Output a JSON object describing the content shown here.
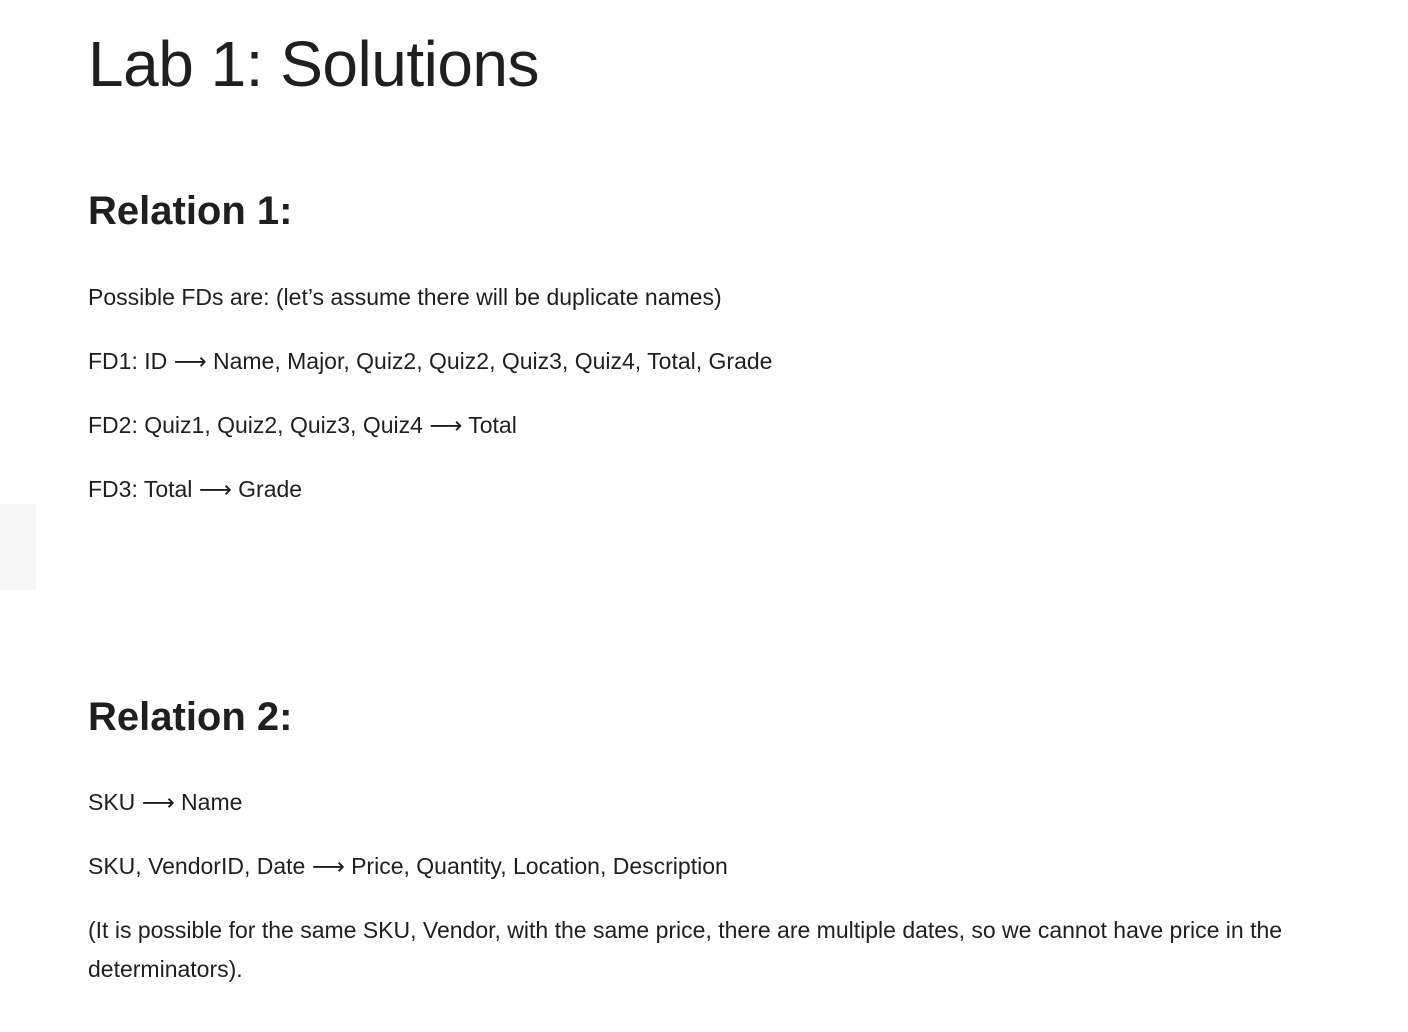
{
  "title": "Lab 1: Solutions",
  "relation1": {
    "heading": "Relation 1:",
    "intro": "Possible FDs are: (let’s assume there will be duplicate names)",
    "fds": [
      "FD1: ID ⟶ Name, Major, Quiz2, Quiz2, Quiz3, Quiz4, Total, Grade",
      "FD2: Quiz1, Quiz2, Quiz3, Quiz4 ⟶ Total",
      "FD3: Total ⟶ Grade"
    ]
  },
  "relation2": {
    "heading": "Relation 2:",
    "fds": [
      "SKU ⟶ Name",
      "SKU, VendorID, Date ⟶ Price, Quantity, Location, Description"
    ],
    "note": "(It is possible for the same SKU, Vendor, with the same price, there are multiple dates, so we cannot have price in the determinators)."
  }
}
